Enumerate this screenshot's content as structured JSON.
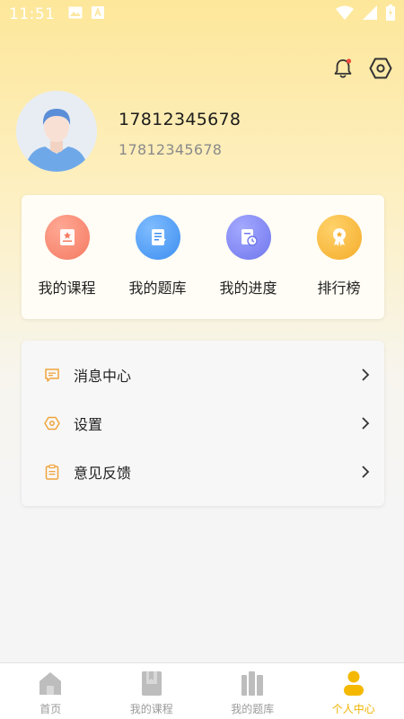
{
  "status_bar": {
    "time": "11:51"
  },
  "profile": {
    "name": "17812345678",
    "phone": "17812345678"
  },
  "shortcuts": [
    {
      "label": "我的课程",
      "icon": "course-icon",
      "color": "#f8836b"
    },
    {
      "label": "我的题库",
      "icon": "question-bank-icon",
      "color": "#4f9cf5"
    },
    {
      "label": "我的进度",
      "icon": "progress-icon",
      "color": "#7f86f1"
    },
    {
      "label": "排行榜",
      "icon": "ranking-icon",
      "color": "#f6b93b"
    }
  ],
  "menu": [
    {
      "label": "消息中心",
      "icon": "message-icon"
    },
    {
      "label": "设置",
      "icon": "settings-icon"
    },
    {
      "label": "意见反馈",
      "icon": "feedback-icon"
    }
  ],
  "tabs": [
    {
      "label": "首页",
      "icon": "home-icon",
      "active": false
    },
    {
      "label": "我的课程",
      "icon": "course-tab-icon",
      "active": false
    },
    {
      "label": "我的题库",
      "icon": "question-bank-tab-icon",
      "active": false
    },
    {
      "label": "个人中心",
      "icon": "profile-tab-icon",
      "active": true
    }
  ],
  "colors": {
    "accent": "#f0b400",
    "header_gradient_top": "#fde79a"
  }
}
